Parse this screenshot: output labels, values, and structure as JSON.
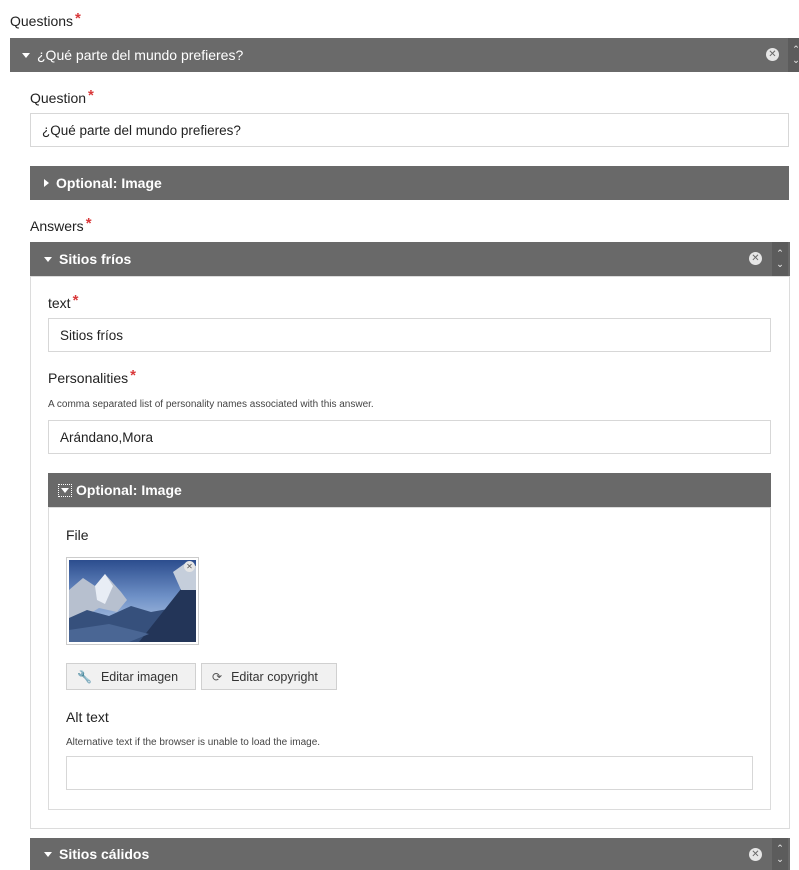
{
  "questions_label": "Questions",
  "required_mark": "*",
  "question_item": {
    "title": "¿Qué parte del mundo prefieres?",
    "question_label": "Question",
    "question_value": "¿Qué parte del mundo prefieres?",
    "optional_image_label": "Optional: Image",
    "answers_label": "Answers"
  },
  "answer1": {
    "title": "Sitios fríos",
    "text_label": "text",
    "text_value": "Sitios fríos",
    "personalities_label": "Personalities",
    "personalities_desc": "A comma separated list of personality names associated with this answer.",
    "personalities_value": "Arándano,Mora",
    "optional_image_label": "Optional: Image",
    "file_label": "File",
    "edit_image_label": "Editar imagen",
    "edit_copyright_label": "Editar copyright",
    "alt_text_label": "Alt text",
    "alt_text_desc": "Alternative text if the browser is unable to load the image.",
    "alt_text_value": ""
  },
  "answer2": {
    "title": "Sitios cálidos"
  },
  "icons": {
    "close": "close-icon",
    "order": "order-icon",
    "wrench": "wrench-icon",
    "copyright": "copyright-icon"
  },
  "colors": {
    "bar": "#696969",
    "required": "#d9383a"
  }
}
